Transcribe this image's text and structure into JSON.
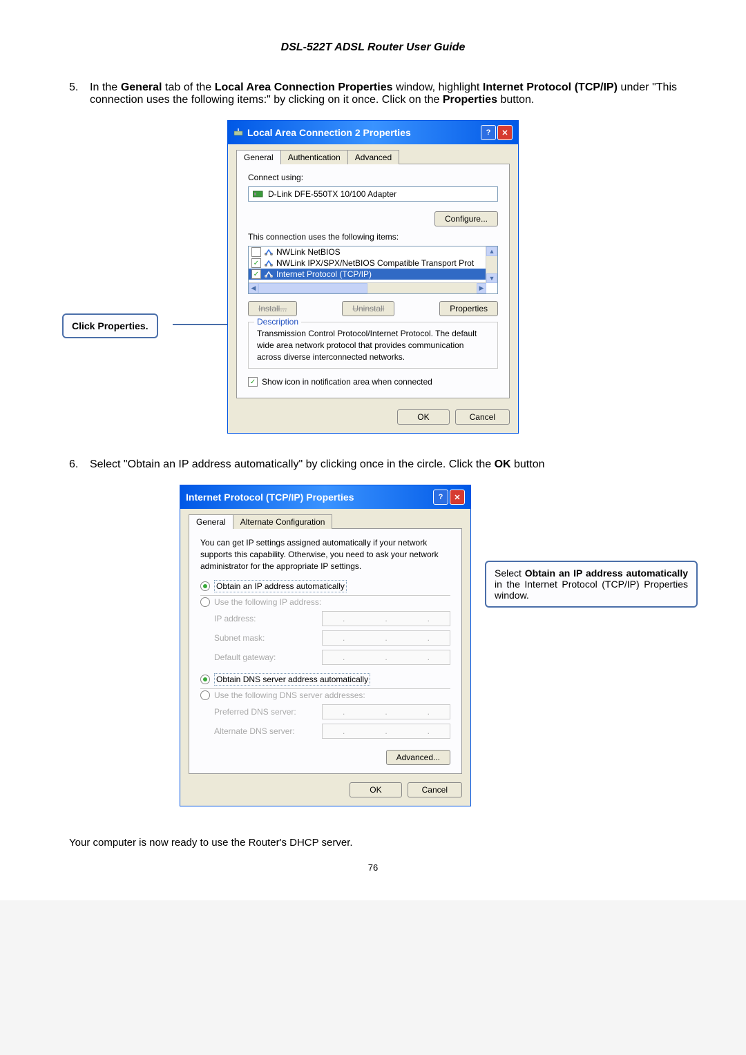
{
  "header": "DSL-522T ADSL Router User Guide",
  "step5": {
    "num": "5.",
    "text_prefix": "In the ",
    "bold1": "General",
    "text_mid1": " tab of the ",
    "bold2": "Local Area Connection Properties",
    "text_mid2": " window, highlight ",
    "bold3": "Internet Protocol (TCP/IP)",
    "text_mid3": " under \"This connection uses the following items:\" by clicking on it once. Click on the ",
    "bold4": "Properties",
    "text_end": " button."
  },
  "dialog1": {
    "title": "Local Area Connection 2 Properties",
    "tabs": {
      "general": "General",
      "auth": "Authentication",
      "advanced": "Advanced"
    },
    "connect_using": "Connect using:",
    "adapter": "D-Link DFE-550TX 10/100 Adapter",
    "configure": "Configure...",
    "uses_items": "This connection uses the following items:",
    "item1": "NWLink NetBIOS",
    "item2": "NWLink IPX/SPX/NetBIOS Compatible Transport Prot",
    "item3": "Internet Protocol (TCP/IP)",
    "install": "Install...",
    "uninstall": "Uninstall",
    "properties": "Properties",
    "description_label": "Description",
    "description_text": "Transmission Control Protocol/Internet Protocol. The default wide area network protocol that provides communication across diverse interconnected networks.",
    "show_icon": "Show icon in notification area when connected",
    "ok": "OK",
    "cancel": "Cancel"
  },
  "callout1": {
    "prefix": "Click ",
    "bold": "Properties",
    "suffix": "."
  },
  "step6": {
    "num": "6.",
    "text_prefix": "Select \"Obtain an IP address automatically\" by clicking once in the circle. Click the ",
    "bold1": "OK",
    "text_end": " button"
  },
  "dialog2": {
    "title": "Internet Protocol (TCP/IP) Properties",
    "tabs": {
      "general": "General",
      "alt": "Alternate Configuration"
    },
    "intro": "You can get IP settings assigned automatically if your network supports this capability. Otherwise, you need to ask your network administrator for the appropriate IP settings.",
    "obtain_auto": "Obtain an IP address automatically",
    "use_following": "Use the following IP address:",
    "ip_address": "IP address:",
    "subnet": "Subnet mask:",
    "gateway": "Default gateway:",
    "obtain_dns": "Obtain DNS server address automatically",
    "use_dns": "Use the following DNS server addresses:",
    "preferred": "Preferred DNS server:",
    "alternate": "Alternate DNS server:",
    "advanced": "Advanced...",
    "ok": "OK",
    "cancel": "Cancel"
  },
  "callout2": {
    "line1_a": "Select ",
    "line1_b": "Obtain an IP address automatically",
    "line1_c": " in the Internet Protocol (TCP/IP) Properties window."
  },
  "footer": "Your computer is now ready to use the Router's DHCP server.",
  "page_num": "76"
}
